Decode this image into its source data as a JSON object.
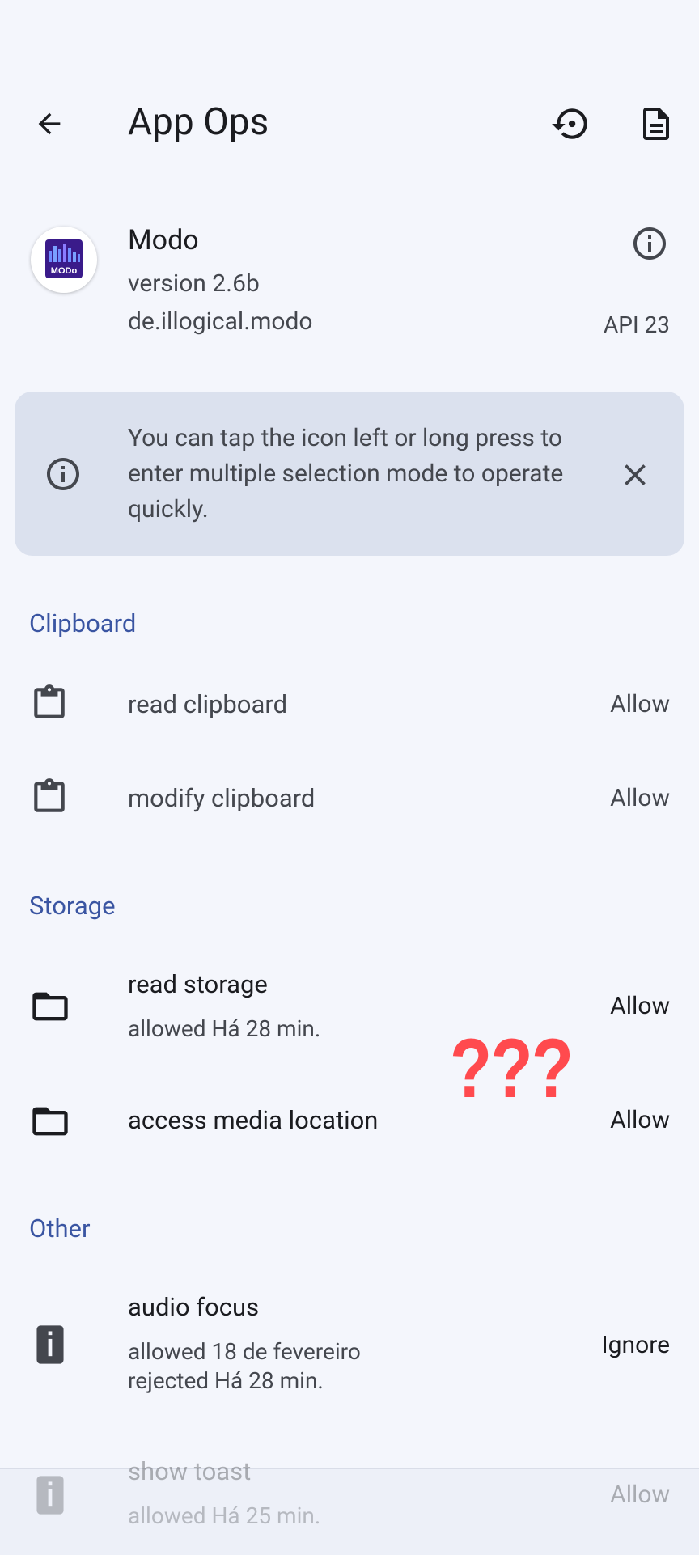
{
  "header": {
    "title": "App Ops",
    "back_icon": "arrow-left-icon",
    "reset_icon": "history-icon",
    "log_icon": "document-icon"
  },
  "app": {
    "name": "Modo",
    "version": "version 2.6b",
    "package": "de.illogical.modo",
    "api": "API 23",
    "icon_text": "MODo",
    "icon_colors": {
      "bg": "#3a1b8a",
      "bars": "#6f8cff"
    }
  },
  "hint": {
    "text": "You can tap the icon left or long press to enter multiple selection mode to operate quickly."
  },
  "sections": {
    "clipboard": {
      "title": "Clipboard",
      "items": [
        {
          "label": "read clipboard",
          "mode": "Allow"
        },
        {
          "label": "modify clipboard",
          "mode": "Allow"
        }
      ]
    },
    "storage": {
      "title": "Storage",
      "items": [
        {
          "label": "read storage",
          "sub": "allowed Há 28 min.",
          "mode": "Allow"
        },
        {
          "label": "access media location",
          "mode": "Allow"
        }
      ]
    },
    "other": {
      "title": "Other",
      "items": [
        {
          "label": "audio focus",
          "sub1": "allowed 18 de fevereiro",
          "sub2": "rejected Há 28 min.",
          "mode": "Ignore"
        },
        {
          "label": "show toast",
          "sub": "allowed Há 25 min.",
          "mode": "Allow"
        }
      ]
    }
  },
  "annotation": "???",
  "colors": {
    "accent": "#3a55a2",
    "annotation": "#ff4a4e",
    "card": "#dbe1ee",
    "background": "#f4f6fc"
  }
}
